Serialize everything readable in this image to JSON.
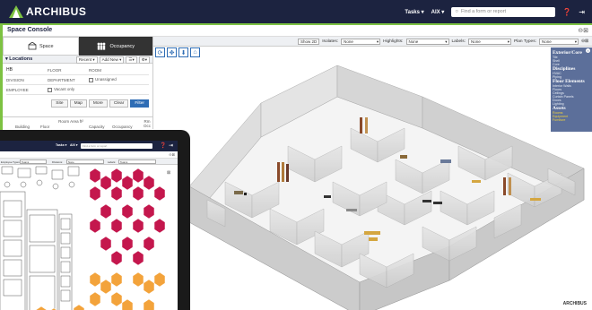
{
  "app": {
    "brand": "ARCHIBUS"
  },
  "topbar": {
    "tasks_label": "Tasks ▾",
    "aix_label": "AIX ▾",
    "search_placeholder": "Find a form or report"
  },
  "console": {
    "title": "Space Console",
    "tools": "⊖⊠"
  },
  "tabs": [
    {
      "label": "Space"
    },
    {
      "label": "Occupancy"
    }
  ],
  "locations": {
    "title": "Locations",
    "recent_label": "Recent ▾",
    "add_new_label": "Add New ▾",
    "fields": {
      "building_value": "HB",
      "floor": "FLOOR",
      "room": "ROOM",
      "division": "DIVISION",
      "department": "DEPARTMENT",
      "unassigned": "Unassigned",
      "employee": "EMPLOYEE",
      "vacant_only": "Vacant only"
    },
    "buttons": {
      "site": "Site",
      "map": "Map",
      "more": "More",
      "clear": "Clear",
      "filter": "Filter"
    },
    "columns": [
      "Building",
      "Floor",
      "Room Area ft²",
      "Capacity",
      "Occupancy",
      "Rm Occ"
    ]
  },
  "viewer_toolbar": {
    "show2d": "Show 2D",
    "isolates_label": "Isolates:",
    "isolates_value": "None",
    "highlights_label": "Highlights:",
    "highlights_value": "None",
    "labels_label": "Labels:",
    "labels_value": "None",
    "plan_types_label": "Plan Types:",
    "plan_types_value": "None"
  },
  "legend": {
    "groups": [
      {
        "heading": "Exterior/Core",
        "items": [
          "Tile",
          "Shell",
          "Core"
        ],
        "highlight": false
      },
      {
        "heading": "Disciplines",
        "items": [
          "HVAC",
          "Piping"
        ],
        "highlight": false
      },
      {
        "heading": "Floor Elements",
        "items": [
          "Interior Walls",
          "Floors",
          "Ceilings",
          "Curtain Panels",
          "Doors",
          "Lighting"
        ],
        "highlight": false
      },
      {
        "heading": "Assets",
        "items": [
          "Rooms",
          "Equipment",
          "Furniture"
        ],
        "highlight": true
      }
    ]
  },
  "footer_brand": "ARCHIBUS",
  "tablet": {
    "tasks_label": "Tasks ▾",
    "aix_label": "AIX ▾",
    "search_placeholder": "Find a form or report",
    "employee_types_label": "Employee Types:",
    "employee_types_value": "Teams",
    "divisions_label": "Divisions:",
    "divisions_value": "None",
    "labels_label": "Labels:",
    "labels_value": "Teams"
  },
  "colors": {
    "navy": "#1c2340",
    "green": "#7dc242",
    "legend_bg": "#5c6f9a",
    "accent_blue": "#2f6db5",
    "crimson": "#c4174d",
    "orange": "#f3a33b"
  }
}
